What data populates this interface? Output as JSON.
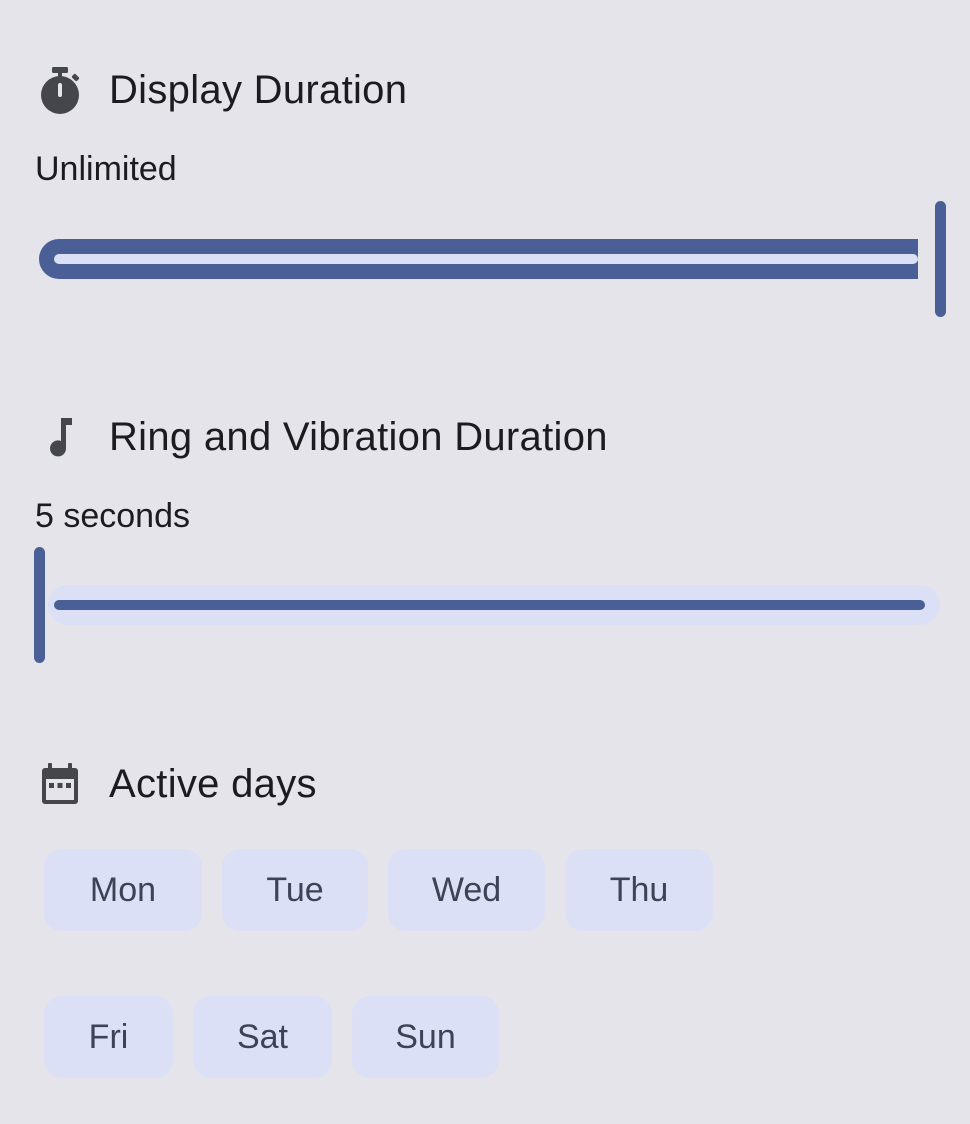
{
  "display_duration": {
    "title": "Display Duration",
    "icon": "timer-icon",
    "value_label": "Unlimited",
    "slider_fraction": 1.0
  },
  "ring_duration": {
    "title": "Ring and Vibration Duration",
    "icon": "music-note-icon",
    "value_label": "5 seconds",
    "slider_fraction": 0.0
  },
  "active_days": {
    "title": "Active days",
    "icon": "calendar-icon",
    "days": [
      "Mon",
      "Tue",
      "Wed",
      "Thu",
      "Fri",
      "Sat",
      "Sun"
    ]
  },
  "colors": {
    "accent": "#4a5f96",
    "track_light": "#dbe0f6",
    "chip_bg": "#dbe0f6",
    "background": "#e5e4ea"
  }
}
